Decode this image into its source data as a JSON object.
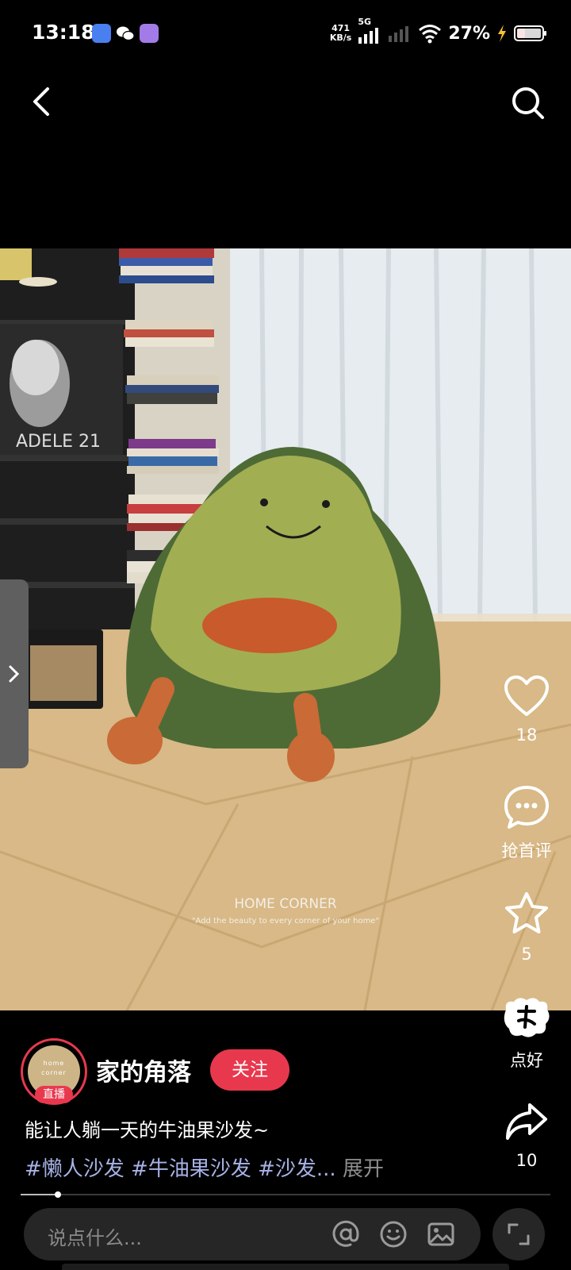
{
  "status_bar": {
    "time": "13:18",
    "net_speed_value": "471",
    "net_speed_unit": "KB/s",
    "network": "5G",
    "battery": "27%"
  },
  "nav": {
    "back_icon": "chevron-left-icon",
    "search_icon": "search-icon"
  },
  "video": {
    "watermark_title": "HOME CORNER",
    "watermark_subtitle": "\"Add the beauty to every corner of your home\"",
    "album_text": "ADELE 21"
  },
  "actions": {
    "like_count": "18",
    "comment_label": "抢首评",
    "favorite_count": "5",
    "nice_label": "点好",
    "share_count": "10"
  },
  "author": {
    "name": "家的角落",
    "live_badge": "直播",
    "avatar_text_1": "home",
    "avatar_text_2": "corner",
    "follow_label": "关注"
  },
  "caption": "能让人躺一天的牛油果沙发~",
  "tags_text": "#懒人沙发 #牛油果沙发 #沙发...",
  "expand_label": "展开",
  "progress": 0.07,
  "comment": {
    "placeholder": "说点什么..."
  },
  "colors": {
    "accent": "#e8384e",
    "tag": "#a7b2e6",
    "background": "#000000"
  }
}
